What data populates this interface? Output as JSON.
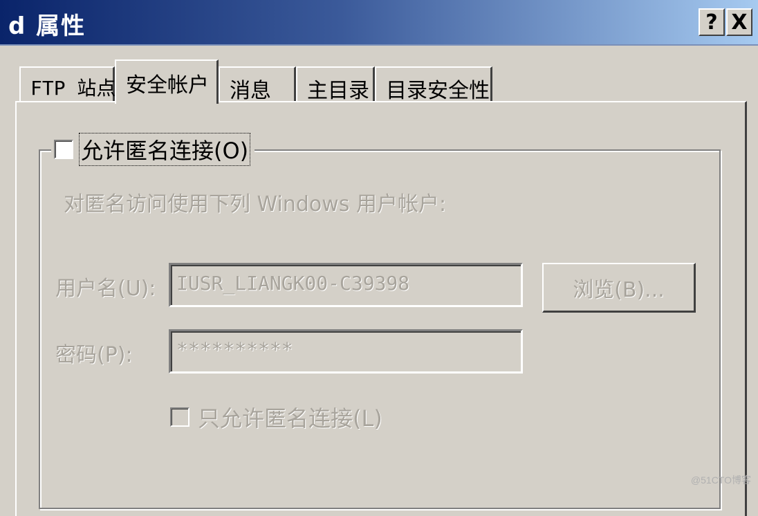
{
  "window": {
    "title": "d 属性",
    "help_button": "?",
    "close_button": "X"
  },
  "tabs": [
    {
      "label": "FTP 站点",
      "active": false
    },
    {
      "label": "安全帐户",
      "active": true
    },
    {
      "label": "消息",
      "active": false
    },
    {
      "label": "主目录",
      "active": false
    },
    {
      "label": "目录安全性",
      "active": false
    }
  ],
  "anonymous_group": {
    "checkbox_label": "允许匿名连接(O)",
    "checked": false,
    "description": "对匿名访问使用下列 Windows 用户帐户:",
    "username_label": "用户名(U):",
    "username_value": "IUSR_LIANGK00-C39398",
    "password_label": "密码(P):",
    "password_value": "**********",
    "browse_button": "浏览(B)...",
    "anon_only_label": "只允许匿名连接(L)",
    "anon_only_checked": false
  },
  "watermark": "@51CTO博客"
}
